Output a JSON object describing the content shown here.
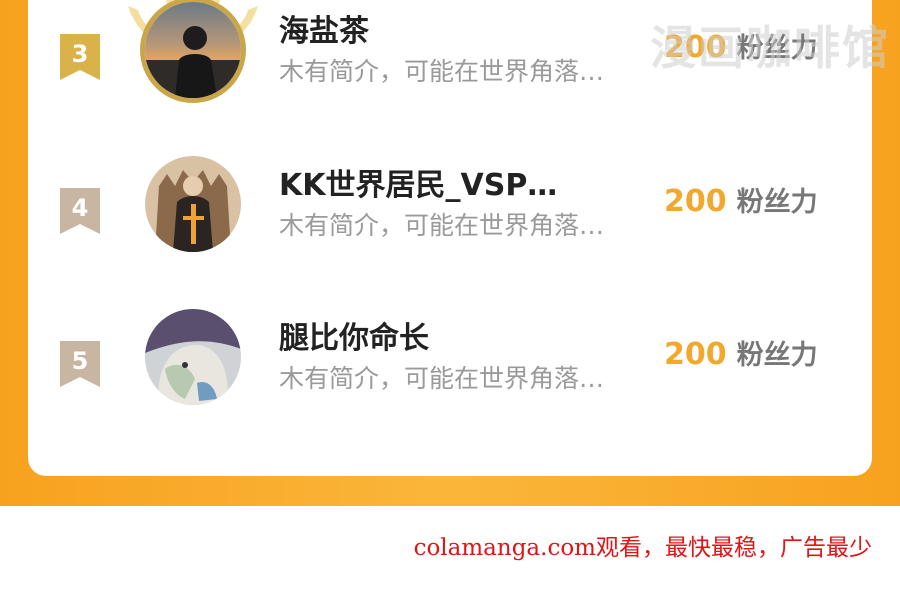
{
  "watermark": "漫画咖啡馆",
  "ranking": [
    {
      "rank": "3",
      "name": "海盐茶",
      "bio": "木有简介，可能在世界角落…",
      "fans_count": "200",
      "fans_label": "粉丝力"
    },
    {
      "rank": "4",
      "name": "KK世界居民_VSP…",
      "bio": "木有简介，可能在世界角落…",
      "fans_count": "200",
      "fans_label": "粉丝力"
    },
    {
      "rank": "5",
      "name": "腿比你命长",
      "bio": "木有简介，可能在世界角落…",
      "fans_count": "200",
      "fans_label": "粉丝力"
    }
  ],
  "footer_text": "colamanga.com观看，最快最稳，广告最少",
  "colors": {
    "accent_orange": "#f7a21f",
    "gold_badge": "#d9b24a",
    "gray_badge": "#c8b6a2",
    "fans_gold": "#f2a82d",
    "footer_red": "#e01515"
  }
}
